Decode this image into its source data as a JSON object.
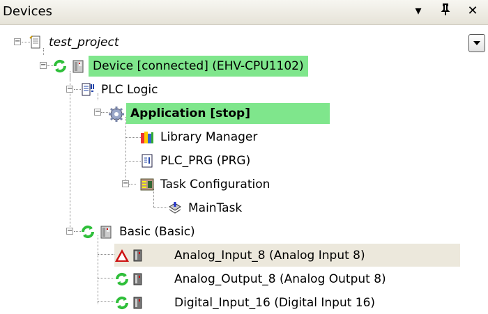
{
  "panel": {
    "title": "Devices",
    "dropdown_glyph": "▾",
    "pin_glyph": "ꟸ",
    "close_glyph": "✕"
  },
  "tree": [
    {
      "label": "test_project",
      "icon": "project-icon"
    },
    {
      "label": "Device [connected] (EHV-CPU1102)",
      "icon": "device-icon",
      "status": "connected-icon"
    },
    {
      "label": "PLC Logic",
      "icon": "plc-logic-icon"
    },
    {
      "label": "Application [stop]",
      "icon": "application-gear-icon"
    },
    {
      "label": "Library Manager",
      "icon": "library-manager-icon"
    },
    {
      "label": "PLC_PRG (PRG)",
      "icon": "program-icon"
    },
    {
      "label": "Task Configuration",
      "icon": "task-configuration-icon"
    },
    {
      "label": "MainTask",
      "icon": "main-task-icon"
    },
    {
      "label": "Basic (Basic)",
      "icon": "device-icon",
      "status": "connected-icon"
    },
    {
      "label": "Analog_Input_8 (Analog Input 8)",
      "icon": "io-module-icon",
      "status": "warning-triangle-icon"
    },
    {
      "label": "Analog_Output_8 (Analog Output 8)",
      "icon": "io-module-icon",
      "status": "connected-icon"
    },
    {
      "label": "Digital_Input_16 (Digital Input 16)",
      "icon": "io-module-icon",
      "status": "connected-icon"
    }
  ],
  "colors": {
    "active_highlight": "#7fe68c",
    "selected_row": "#ece8dc",
    "status_green": "#2fbf3a",
    "warning_red": "#cc1111"
  },
  "expand_glyph": "−"
}
